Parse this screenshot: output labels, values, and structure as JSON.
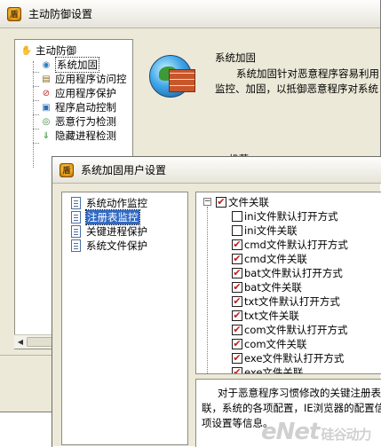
{
  "main_window": {
    "title": "主动防御设置",
    "tree": {
      "root": "主动防御",
      "items": [
        "系统加固",
        "应用程序访问控",
        "应用程序保护",
        "程序启动控制",
        "恶意行为检测",
        "隐藏进程检测"
      ]
    },
    "heading": "系统加固",
    "description_lines": [
      "系统加固针对恶意程序容易利用",
      "监控、加固，以抵御恶意程序对系统"
    ],
    "recommend_label": "推荐"
  },
  "dialog": {
    "title": "系统加固用户设置",
    "list": [
      "系统动作监控",
      "注册表监控",
      "关键进程保护",
      "系统文件保护"
    ],
    "selected_index": 1,
    "tree": {
      "root": "文件关联",
      "items": [
        {
          "label": "ini文件默认打开方式",
          "checked": false
        },
        {
          "label": "ini文件关联",
          "checked": false
        },
        {
          "label": "cmd文件默认打开方式",
          "checked": true
        },
        {
          "label": "cmd文件关联",
          "checked": true
        },
        {
          "label": "bat文件默认打开方式",
          "checked": true
        },
        {
          "label": "bat文件关联",
          "checked": true
        },
        {
          "label": "txt文件默认打开方式",
          "checked": true
        },
        {
          "label": "txt文件关联",
          "checked": true
        },
        {
          "label": "com文件默认打开方式",
          "checked": true
        },
        {
          "label": "com文件关联",
          "checked": true
        },
        {
          "label": "exe文件默认打开方式",
          "checked": true
        },
        {
          "label": "exe文件关联",
          "checked": true
        }
      ]
    },
    "description_lines": [
      "对于恶意程序习惯修改的关键注册表",
      "联，系统的各项配置，IE浏览器的配置信",
      "项设置等信息。"
    ]
  },
  "watermark": {
    "text": "eNet",
    "sub": "硅谷动力"
  },
  "colors": {
    "selection": "#316ac5",
    "check": "#c41a1a",
    "window_bg": "#ece9d8"
  }
}
